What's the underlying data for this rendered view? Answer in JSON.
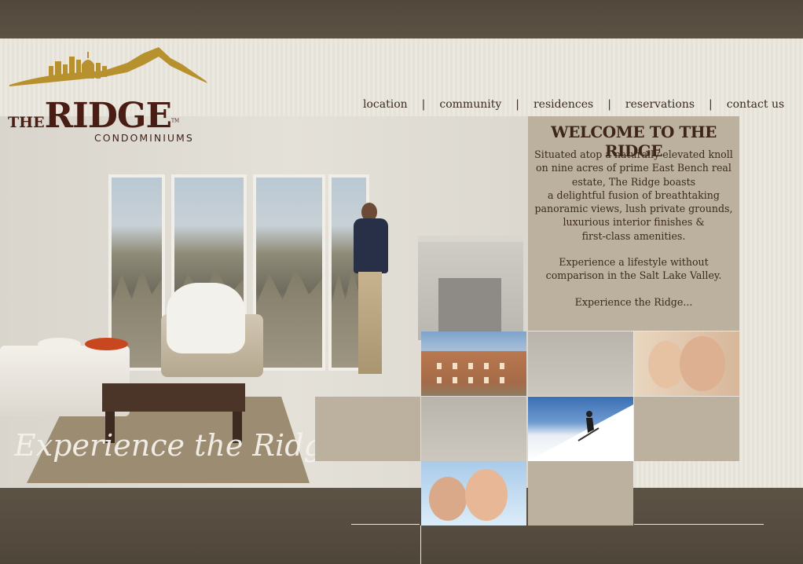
{
  "brand": {
    "the": "The",
    "ridge": "Ridge",
    "tm": "TM",
    "condominiums": "CONDOMINIUMS"
  },
  "nav": {
    "items": [
      {
        "label": "location"
      },
      {
        "label": "community"
      },
      {
        "label": "residences"
      },
      {
        "label": "reservations"
      },
      {
        "label": "contact us"
      }
    ],
    "separator": "|"
  },
  "welcome": {
    "title": "WELCOME TO THE RIDGE",
    "paragraph1": "Situated atop a naturally elevated knoll\non nine acres of prime East Bench real\nestate, The Ridge boasts\na delightful fusion of breathtaking\npanoramic views, lush private grounds,\nluxurious interior finishes &\nfirst-class amenities.",
    "paragraph2": "Experience a lifestyle without\ncomparison in the Salt Lake Valley.",
    "paragraph3": "Experience the Ridge..."
  },
  "tagline": "Experience the Ridge...",
  "colors": {
    "topbar": "#51473b",
    "panel": "#bbb19e",
    "brand": "#4a1d14",
    "logo_gold": "#b8912f"
  }
}
